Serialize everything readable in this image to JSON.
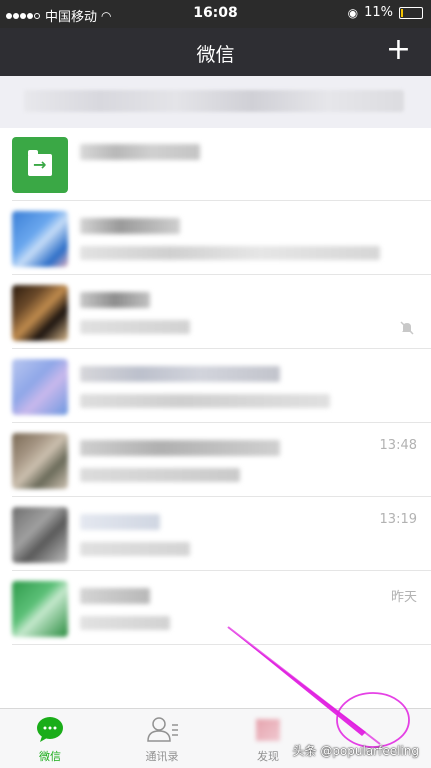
{
  "status_bar": {
    "carrier": "中国移动",
    "time": "16:08",
    "battery": "11%",
    "battery_level": 0.11
  },
  "nav": {
    "title": "微信",
    "add_icon": "plus-icon"
  },
  "chats": [
    {
      "time": ""
    },
    {
      "time": ""
    },
    {
      "time": "",
      "muted": true
    },
    {
      "time": ""
    },
    {
      "time": "13:48"
    },
    {
      "time": "13:19"
    },
    {
      "time": "昨天"
    }
  ],
  "tabs": [
    {
      "label": "微信",
      "icon": "chat-bubble-icon",
      "active": true
    },
    {
      "label": "通讯录",
      "icon": "contacts-icon",
      "active": false
    },
    {
      "label": "发现",
      "icon": "discover-icon",
      "active": false
    }
  ],
  "watermark": "头条 @popularfeeling",
  "colors": {
    "accent": "#1aad19",
    "nav_bg": "#2e2e33",
    "annotation": "#e020e0"
  }
}
